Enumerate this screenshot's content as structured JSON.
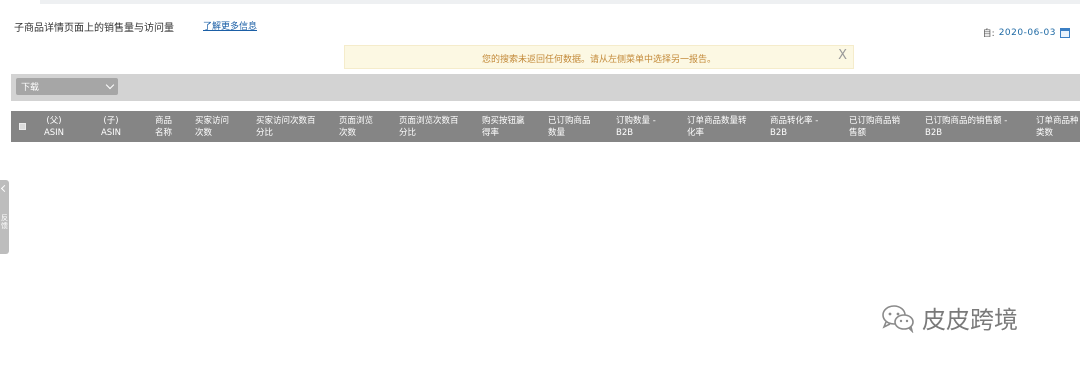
{
  "header": {
    "title": "子商品详情页面上的销售量与访问量",
    "learn_more": "了解更多信息",
    "date_label": "自:",
    "date_value": "2020-06-03"
  },
  "alert": {
    "message": "您的搜索未返回任何数据。请从左侧菜单中选择另一报告。",
    "close": "X"
  },
  "toolbar": {
    "download_label": "下载"
  },
  "table": {
    "columns": [
      {
        "line1": "(父)",
        "line2": "ASIN"
      },
      {
        "line1": "(子)",
        "line2": "ASIN"
      },
      {
        "line1": "商品",
        "line2": "名称"
      },
      {
        "line1": "买家访问",
        "line2": "次数"
      },
      {
        "line1": "买家访问次数百",
        "line2": "分比"
      },
      {
        "line1": "页面浏览",
        "line2": "次数"
      },
      {
        "line1": "页面浏览次数百",
        "line2": "分比"
      },
      {
        "line1": "购买按钮赢",
        "line2": "得率"
      },
      {
        "line1": "已订购商品",
        "line2": "数量"
      },
      {
        "line1": "订购数量 -",
        "line2": "B2B"
      },
      {
        "line1": "订单商品数量转",
        "line2": "化率"
      },
      {
        "line1": "商品转化率 -",
        "line2": "B2B"
      },
      {
        "line1": "已订购商品销",
        "line2": "售额"
      },
      {
        "line1": "已订购商品的销售额 -",
        "line2": "B2B"
      },
      {
        "line1": "订单商品种",
        "line2": "类数"
      }
    ]
  },
  "side_tab": {
    "label": "反馈"
  },
  "watermark": {
    "text": "皮皮跨境"
  }
}
